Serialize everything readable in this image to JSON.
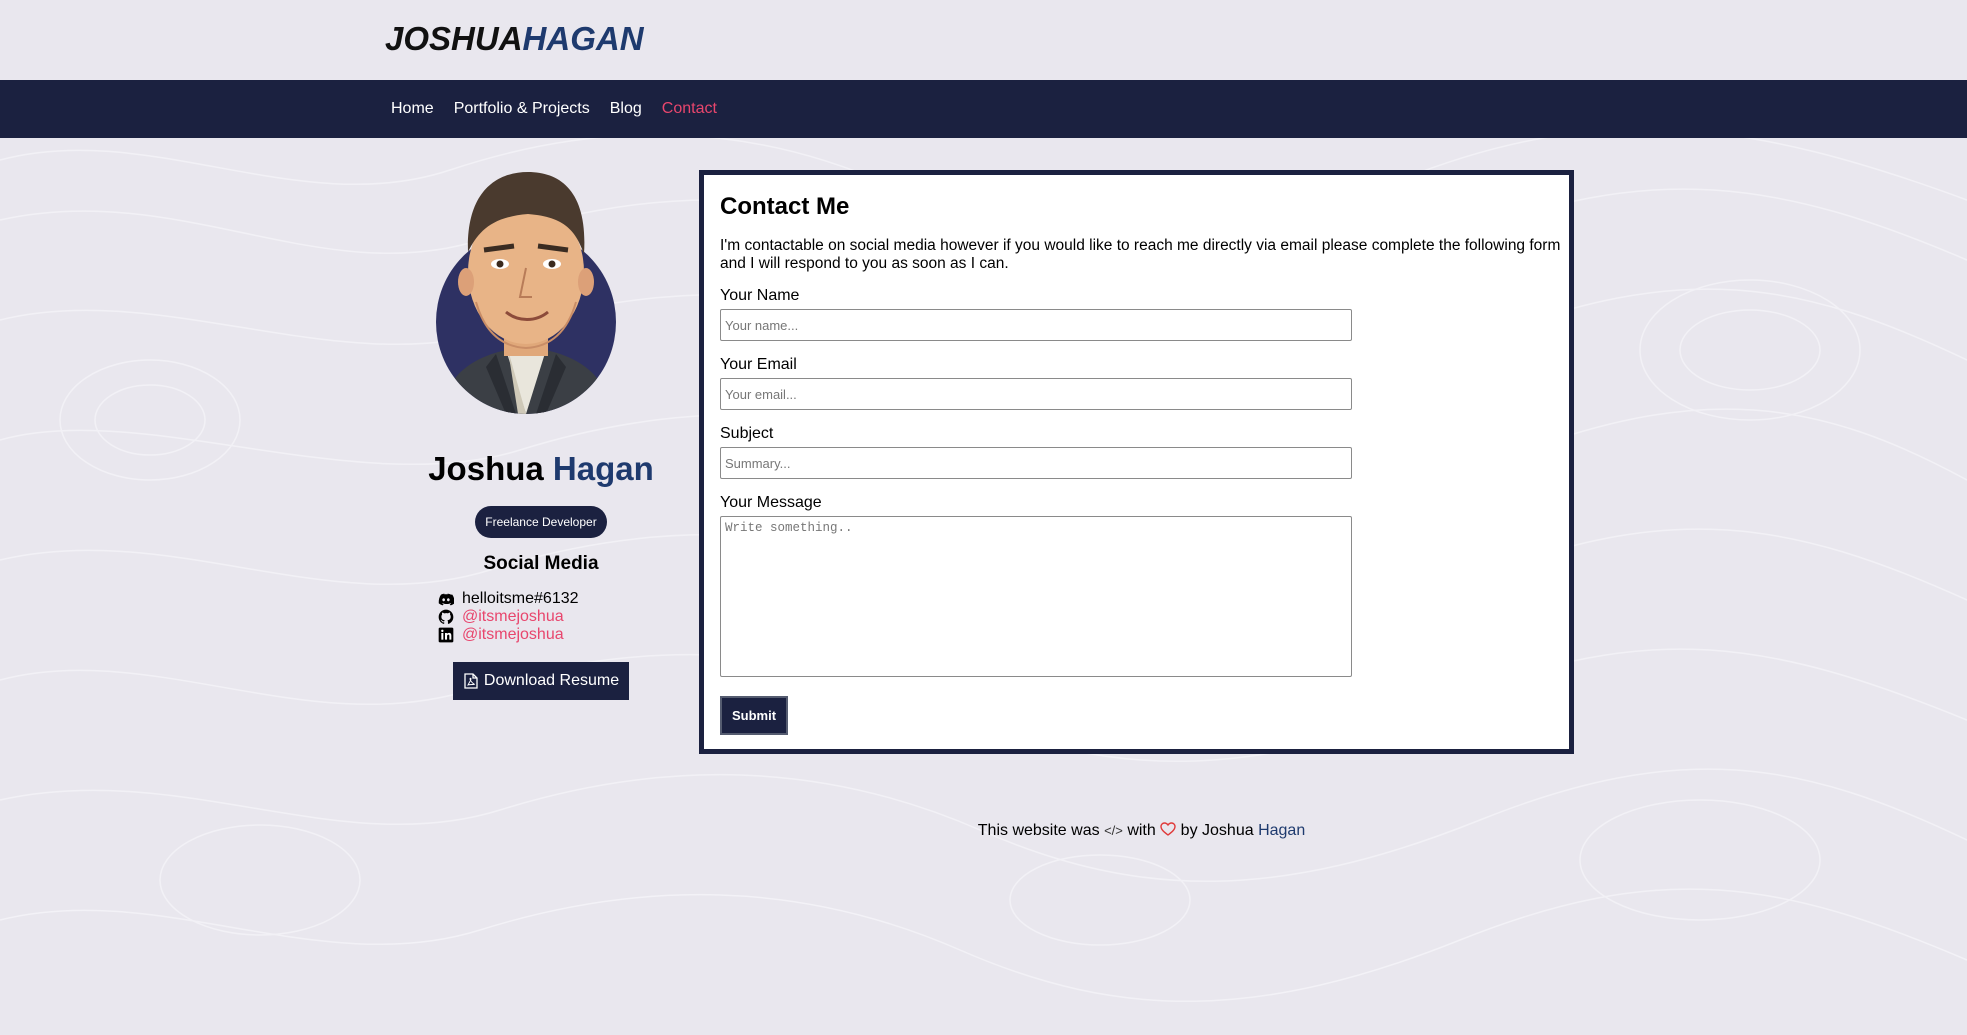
{
  "header": {
    "logo_first": "JOSHUA",
    "logo_last": "HAGAN"
  },
  "nav": [
    {
      "label": "Home"
    },
    {
      "label": "Portfolio & Projects"
    },
    {
      "label": "Blog"
    },
    {
      "label": "Contact",
      "active": true
    }
  ],
  "profile": {
    "first_name": "Joshua",
    "last_name": "Hagan",
    "badge": "Freelance Developer",
    "social_title": "Social Media",
    "social": [
      {
        "icon": "discord-icon",
        "label": "helloitsme#6132"
      },
      {
        "icon": "github-icon",
        "label": "@itsmejoshua"
      },
      {
        "icon": "linkedin-icon",
        "label": "@itsmejoshua"
      }
    ],
    "resume_label": "Download Resume"
  },
  "contact": {
    "title": "Contact Me",
    "intro": "I'm contactable on social media however if you would like to reach me directly via email please complete the following form and I will respond to you as soon as I can.",
    "name_label": "Your Name",
    "name_placeholder": "Your name...",
    "email_label": "Your Email",
    "email_placeholder": "Your email...",
    "subject_label": "Subject",
    "subject_placeholder": "Summary...",
    "message_label": "Your Message",
    "message_placeholder": "Write something..",
    "submit_label": "Submit"
  },
  "footer": {
    "prefix": "This website was",
    "code_glyph": "</>",
    "with": "with",
    "by": "by Joshua",
    "last": "Hagan"
  },
  "colors": {
    "navy": "#1b2140",
    "accent_pink": "#e8466d",
    "name_blue": "#1e3a6e",
    "background": "#e9e7ee"
  }
}
